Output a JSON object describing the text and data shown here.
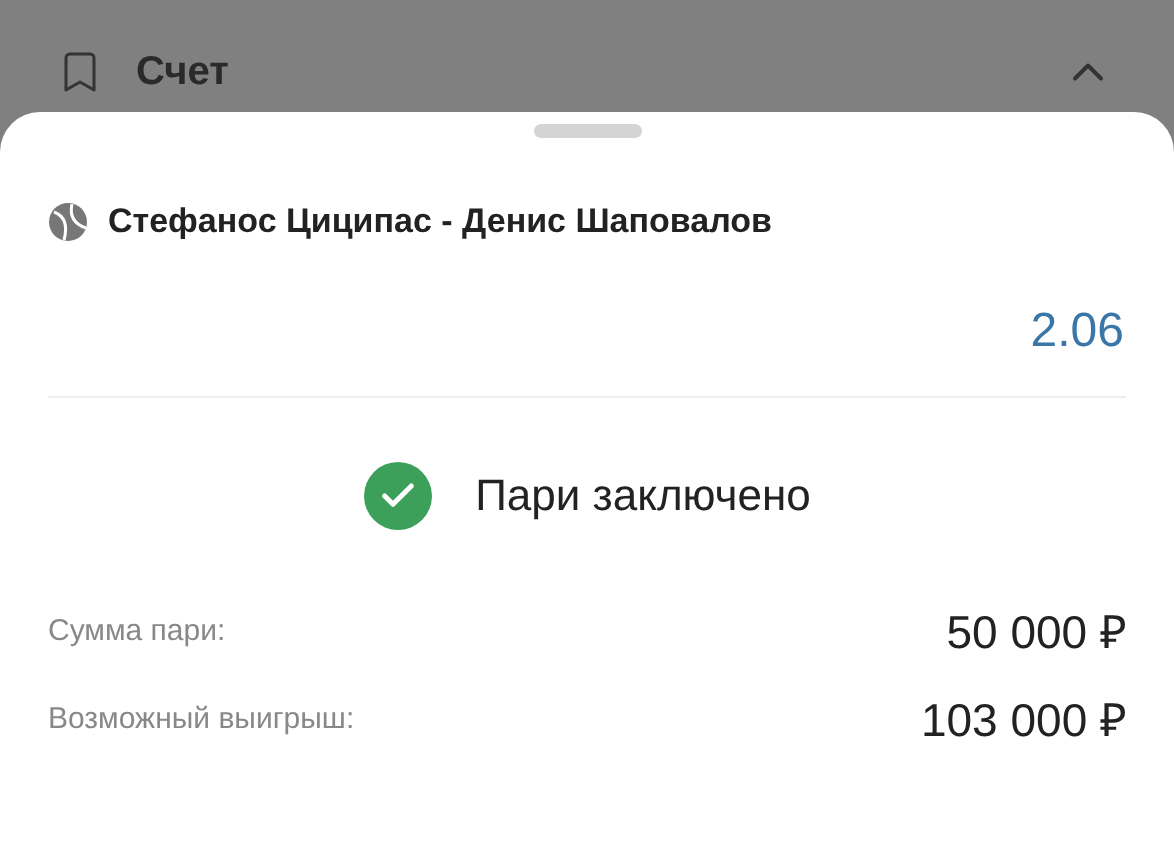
{
  "header": {
    "title": "Счет",
    "expanded": true
  },
  "bet": {
    "match": "Стефанос Циципас - Денис Шаповалов",
    "odds": "2.06",
    "status": "Пари заключено",
    "rows": [
      {
        "label": "Сумма пари:",
        "value": "50 000 ₽"
      },
      {
        "label": "Возможный выигрыш:",
        "value": "103 000 ₽"
      }
    ]
  }
}
